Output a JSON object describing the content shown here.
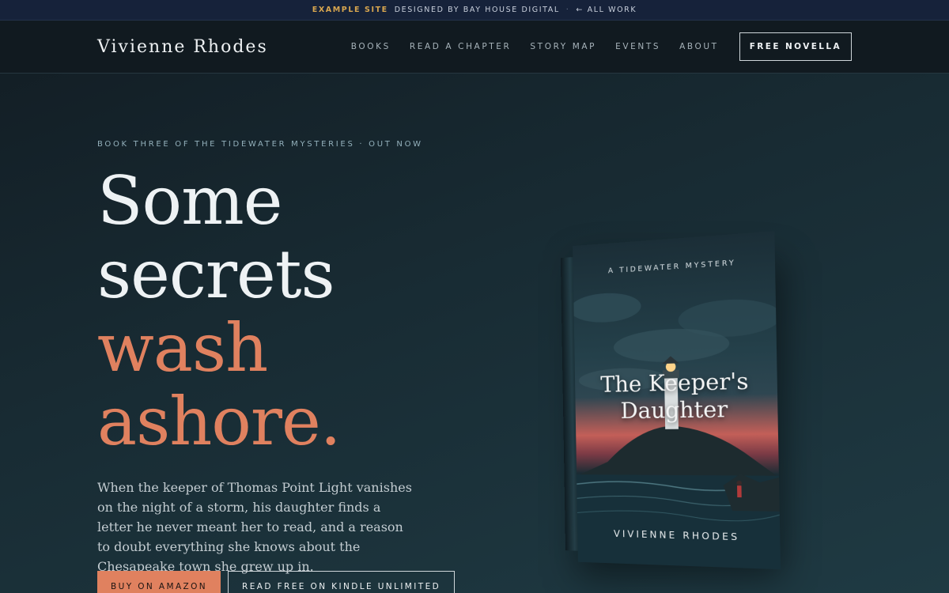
{
  "banner": {
    "tag": "EXAMPLE SITE",
    "credit": "DESIGNED BY BAY HOUSE DIGITAL",
    "separator": "·",
    "back_link": "← ALL WORK"
  },
  "nav": {
    "brand": "Vivienne Rhodes",
    "links": [
      "BOOKS",
      "READ A CHAPTER",
      "STORY MAP",
      "EVENTS",
      "ABOUT"
    ],
    "cta": "FREE NOVELLA"
  },
  "hero": {
    "eyebrow": "BOOK THREE OF THE TIDEWATER MYSTERIES · OUT NOW",
    "headline_lines": [
      "Some",
      "secrets"
    ],
    "headline_accent_lines": [
      "wash",
      "ashore."
    ],
    "description": "When the keeper of Thomas Point Light vanishes on the night of a storm, his daughter finds a letter he never meant her to read, and a reason to doubt everything she knows about the Chesapeake town she grew up in.",
    "buttons": {
      "primary": "BUY ON AMAZON",
      "secondary": "READ FREE ON KINDLE UNLIMITED"
    }
  },
  "book": {
    "kicker": "A TIDEWATER MYSTERY",
    "title_line1": "The Keeper's",
    "title_line2": "Daughter",
    "author": "VIVIENNE RHODES"
  },
  "colors": {
    "accent": "#e0815f",
    "banner_tag": "#d8a64f",
    "background": "#182b33"
  }
}
